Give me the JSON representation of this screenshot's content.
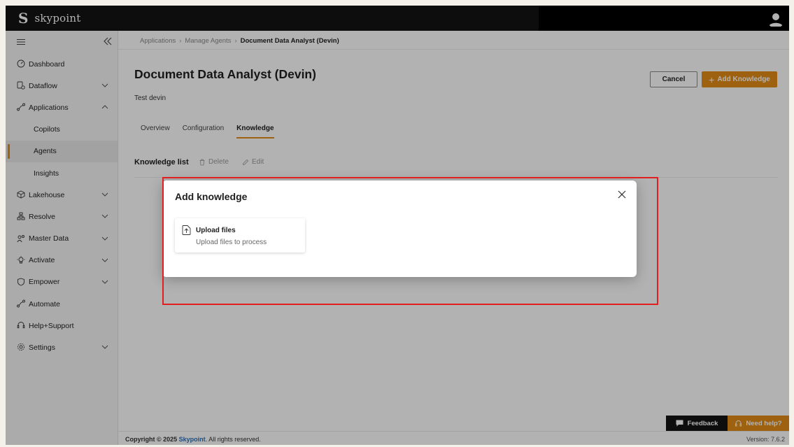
{
  "topbar": {
    "logo_letter": "S",
    "brand": "skypoint"
  },
  "sidebar": {
    "items": [
      {
        "label": "Dashboard",
        "icon": "dashboard-icon",
        "chevron": ""
      },
      {
        "label": "Dataflow",
        "icon": "dataflow-icon",
        "chevron": "down"
      },
      {
        "label": "Applications",
        "icon": "applications-icon",
        "chevron": "up"
      },
      {
        "label": "Copilots",
        "sub": true
      },
      {
        "label": "Agents",
        "sub": true,
        "active": true
      },
      {
        "label": "Insights",
        "sub": true
      },
      {
        "label": "Lakehouse",
        "icon": "cube-icon",
        "chevron": "down"
      },
      {
        "label": "Resolve",
        "icon": "hierarchy-icon",
        "chevron": "down"
      },
      {
        "label": "Master Data",
        "icon": "people-icon",
        "chevron": "down"
      },
      {
        "label": "Activate",
        "icon": "bulb-icon",
        "chevron": "down"
      },
      {
        "label": "Empower",
        "icon": "shield-icon",
        "chevron": "down"
      },
      {
        "label": "Automate",
        "icon": "flow-icon",
        "chevron": ""
      },
      {
        "label": "Help+Support",
        "icon": "headset-icon",
        "chevron": ""
      },
      {
        "label": "Settings",
        "icon": "gear-icon",
        "chevron": "down"
      }
    ]
  },
  "breadcrumb": {
    "items": [
      "Applications",
      "Manage Agents"
    ],
    "current": "Document Data Analyst (Devin)"
  },
  "page": {
    "title": "Document Data Analyst (Devin)",
    "subtitle": "Test devin",
    "cancel_label": "Cancel",
    "add_label": "Add Knowledge",
    "tabs": [
      "Overview",
      "Configuration",
      "Knowledge"
    ],
    "active_tab": "Knowledge",
    "list_title": "Knowledge list",
    "delete_label": "Delete",
    "edit_label": "Edit"
  },
  "dialog": {
    "title": "Add knowledge",
    "option_title": "Upload files",
    "option_desc": "Upload files to process"
  },
  "footer": {
    "copyright": "Copyright © 2025",
    "company": "Skypoint",
    "rights": ". All rights reserved.",
    "version": "Version: 7.6.2",
    "feedback_label": "Feedback",
    "help_label": "Need help?"
  },
  "colors": {
    "accent": "#e18b16",
    "topbar": "#141414",
    "highlight": "#e02020"
  }
}
